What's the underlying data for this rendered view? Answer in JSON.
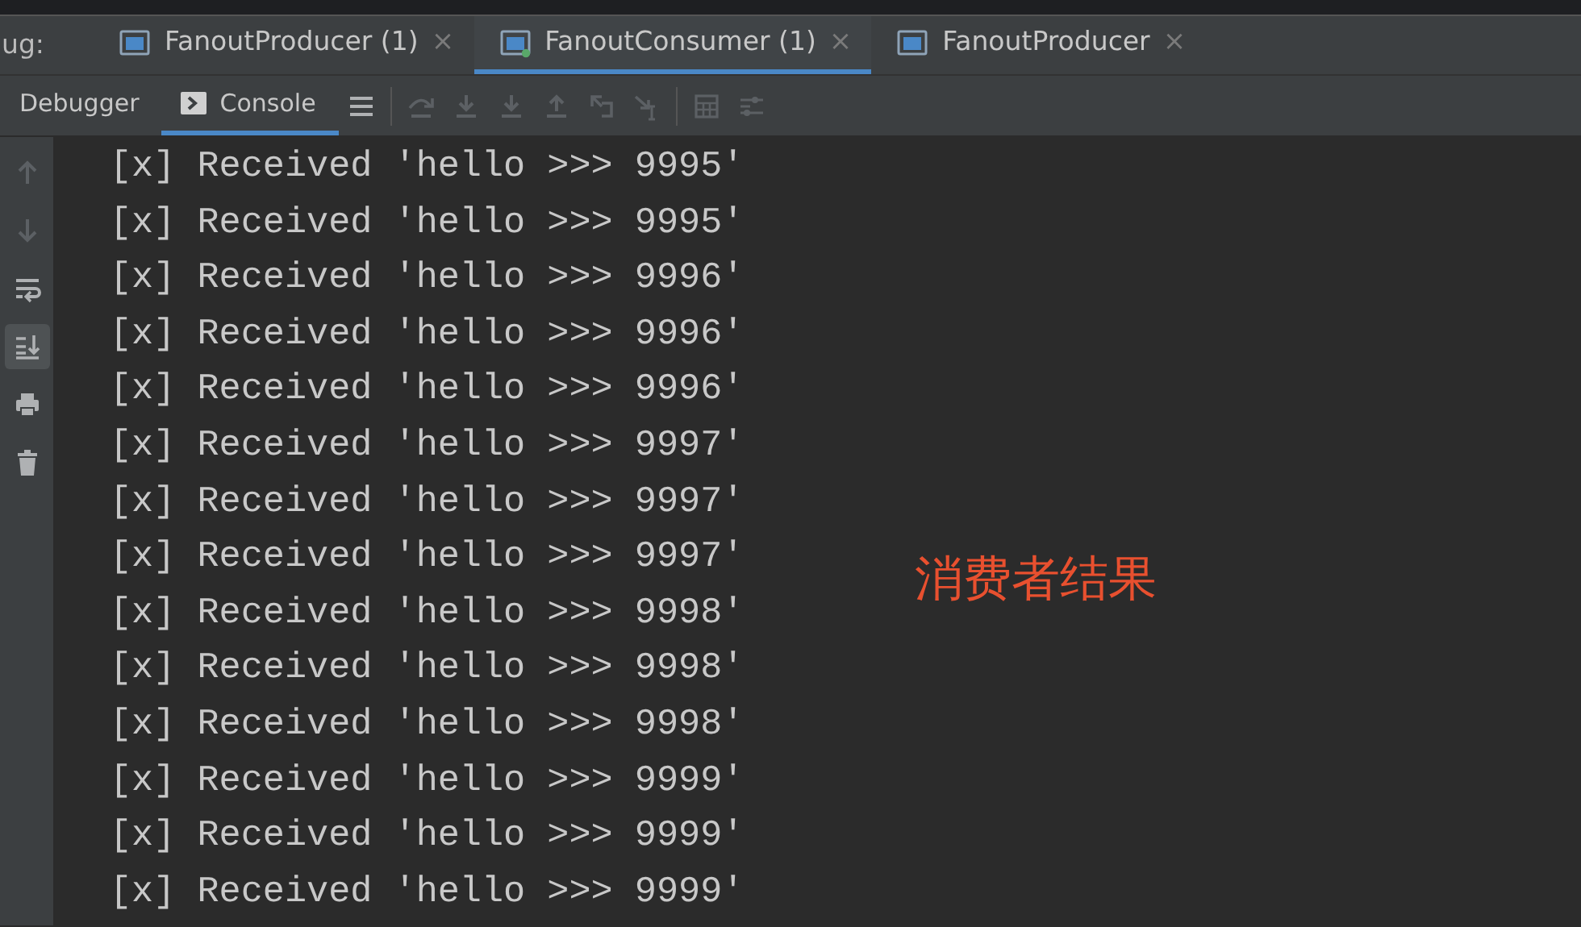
{
  "debug_label": "ug:",
  "run_tabs": [
    {
      "label": "FanoutProducer (1)",
      "selected": false,
      "running": false,
      "close": "×"
    },
    {
      "label": "FanoutConsumer (1)",
      "selected": true,
      "running": true,
      "close": "×"
    },
    {
      "label": "FanoutProducer",
      "selected": false,
      "running": false,
      "close": "×"
    }
  ],
  "tool_tabs": [
    {
      "label": "Debugger",
      "selected": false,
      "kind": "plain"
    },
    {
      "label": "Console",
      "selected": true,
      "kind": "console"
    }
  ],
  "toolbar_buttons": [
    {
      "kind": "menu",
      "disabled": false
    },
    {
      "kind": "step-over",
      "disabled": true
    },
    {
      "kind": "step-into",
      "disabled": true
    },
    {
      "kind": "force-step-into",
      "disabled": true
    },
    {
      "kind": "step-out",
      "disabled": true
    },
    {
      "kind": "drop-frame",
      "disabled": true
    },
    {
      "kind": "run-to-cursor",
      "disabled": true
    },
    {
      "kind": "evaluate",
      "disabled": true
    },
    {
      "kind": "trace",
      "disabled": true
    }
  ],
  "gutter_buttons": [
    {
      "kind": "up",
      "disabled": true,
      "selected": false
    },
    {
      "kind": "down",
      "disabled": true,
      "selected": false
    },
    {
      "kind": "wrap",
      "disabled": false,
      "selected": false
    },
    {
      "kind": "scroll-end",
      "disabled": false,
      "selected": true
    },
    {
      "kind": "print",
      "disabled": false,
      "selected": false
    },
    {
      "kind": "trash",
      "disabled": false,
      "selected": false
    }
  ],
  "console_lines": [
    "[x] Received 'hello >>> 9995'",
    "[x] Received 'hello >>> 9995'",
    "[x] Received 'hello >>> 9996'",
    "[x] Received 'hello >>> 9996'",
    "[x] Received 'hello >>> 9996'",
    "[x] Received 'hello >>> 9997'",
    "[x] Received 'hello >>> 9997'",
    "[x] Received 'hello >>> 9997'",
    "[x] Received 'hello >>> 9998'",
    "[x] Received 'hello >>> 9998'",
    "[x] Received 'hello >>> 9998'",
    "[x] Received 'hello >>> 9999'",
    "[x] Received 'hello >>> 9999'",
    "[x] Received 'hello >>> 9999'"
  ],
  "annotation": "消费者结果"
}
